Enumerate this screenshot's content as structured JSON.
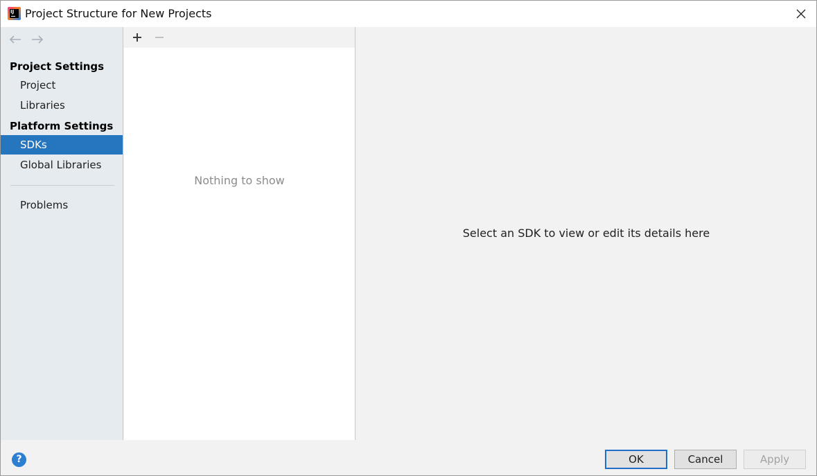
{
  "window": {
    "title": "Project Structure for New Projects",
    "app_icon_text": "IJ"
  },
  "sidebar": {
    "sections": [
      {
        "title": "Project Settings",
        "items": [
          {
            "label": "Project"
          },
          {
            "label": "Libraries"
          }
        ]
      },
      {
        "title": "Platform Settings",
        "items": [
          {
            "label": "SDKs",
            "selected": true
          },
          {
            "label": "Global Libraries"
          }
        ]
      }
    ],
    "bottom_items": [
      {
        "label": "Problems"
      }
    ]
  },
  "list_panel": {
    "empty_text": "Nothing to show"
  },
  "details_panel": {
    "placeholder_text": "Select an SDK to view or edit its details here"
  },
  "footer": {
    "help_label": "?",
    "ok_label": "OK",
    "cancel_label": "Cancel",
    "apply_label": "Apply"
  },
  "colors": {
    "selection": "#2675bf",
    "sidebar_bg": "#e6ebf0",
    "help_icon": "#2d7fd2",
    "ok_border": "#1f6fc9"
  }
}
